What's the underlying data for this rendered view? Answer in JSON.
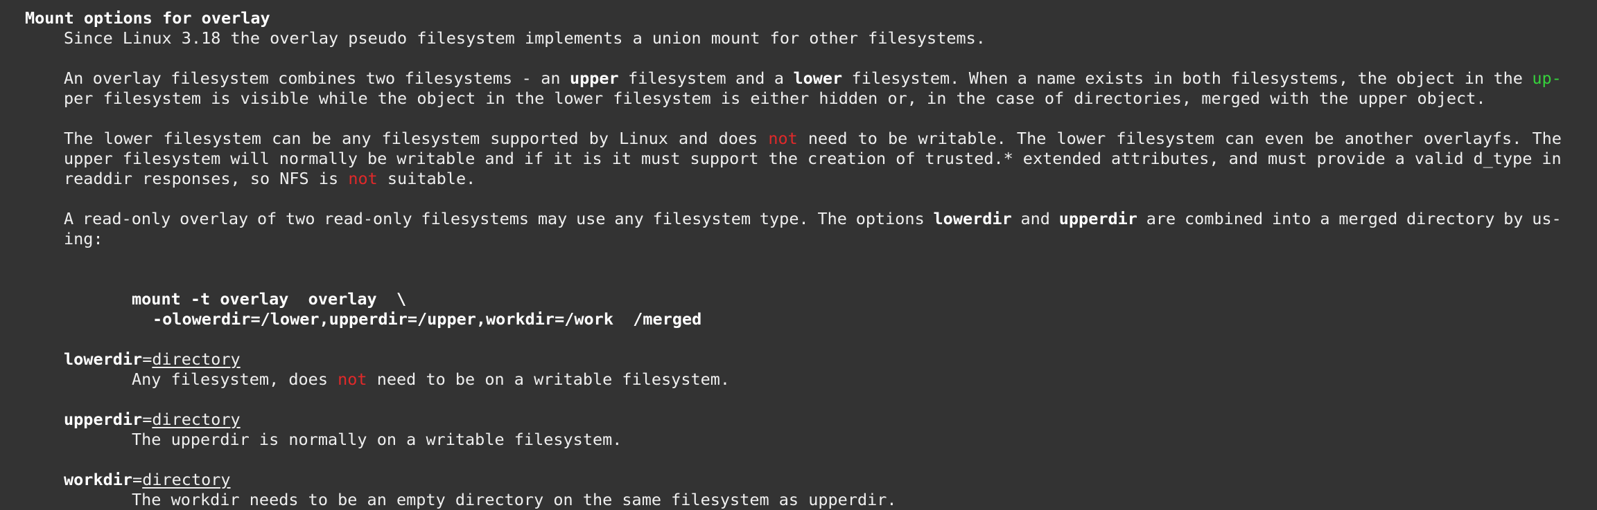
{
  "colors": {
    "background": "#333333",
    "text": "#efefef",
    "keyword_red": "#e0292a",
    "hyphen_green": "#36d13c"
  },
  "section": {
    "title": "Mount options for overlay"
  },
  "p1": {
    "l1": "Since Linux 3.18 the overlay pseudo filesystem implements a union mount for other filesystems."
  },
  "p2": {
    "l1": [
      "An",
      "overlay",
      "filesystem",
      "combines",
      "two",
      "filesystems",
      "-",
      "an",
      "upper",
      "filesystem",
      "and",
      "a",
      "lower",
      "filesystem.",
      "When",
      "a",
      "name",
      "exists",
      "in",
      "both",
      "filesystems,",
      "the",
      "object",
      "in",
      "the",
      "up-"
    ],
    "l2": "per filesystem is visible while the object in the lower filesystem is either hidden or, in the case of directories, merged with the upper object."
  },
  "p3": {
    "l1": [
      "The",
      "lower",
      "filesystem",
      "can",
      "be",
      "any",
      "filesystem",
      "supported",
      "by",
      "Linux",
      "and",
      "does",
      "not",
      "need",
      "to",
      "be",
      "writable.",
      "The",
      "lower",
      "filesystem",
      "can",
      "even",
      "be",
      "another",
      "overlayfs.",
      "The"
    ],
    "l2": [
      "upper",
      "filesystem",
      "will",
      "normally",
      "be",
      "writable",
      "and",
      "if",
      "it",
      "is",
      "it",
      "must",
      "support",
      "the",
      "creation",
      "of",
      "trusted.*",
      "extended",
      "attributes,",
      "and",
      "must",
      "provide",
      "a",
      "valid",
      "d_type",
      "in"
    ],
    "l3_a": "readdir responses, so NFS is ",
    "l3_not": "not",
    "l3_b": " suitable."
  },
  "p4": {
    "l1": [
      "A",
      "read-only",
      "overlay",
      "of",
      "two",
      "read-only",
      "filesystems",
      "may",
      "use",
      "any",
      "filesystem",
      "type.",
      "The",
      "options",
      "lowerdir",
      "and",
      "upperdir",
      "are",
      "combined",
      "into",
      "a",
      "merged",
      "directory",
      "by",
      "us-"
    ],
    "l2": "ing:"
  },
  "example": {
    "l1": "mount -t overlay  overlay  \\",
    "l2": "-olowerdir=/lower,upperdir=/upper,workdir=/work  /merged"
  },
  "options": [
    {
      "name": "lowerdir",
      "eq": "=",
      "arg": "directory",
      "desc_a": "Any filesystem, does ",
      "desc_not": "not",
      "desc_b": " need to be on a writable filesystem."
    },
    {
      "name": "upperdir",
      "eq": "=",
      "arg": "directory",
      "desc": "The upperdir is normally on a writable filesystem."
    },
    {
      "name": "workdir",
      "eq": "=",
      "arg": "directory",
      "desc": "The workdir needs to be an empty directory on the same filesystem as upperdir."
    }
  ]
}
